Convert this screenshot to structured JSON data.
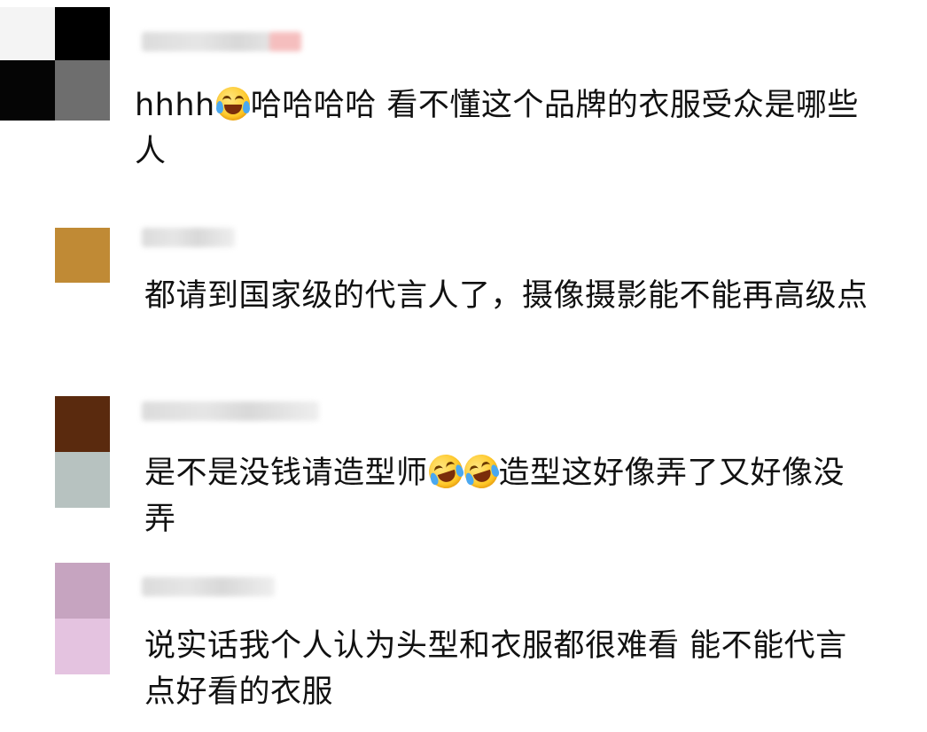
{
  "comments": [
    {
      "text_before": "hhhh",
      "text_after": "哈哈哈哈 看不懂这个品牌的衣服受众是哪些人",
      "emoji_1": "joy-tears-emoji",
      "avatar_colors": [
        "#000000",
        "#4a4a4a",
        "#1a1a1a",
        "#7a7a7a"
      ],
      "username_tint": "#f2a7a7"
    },
    {
      "text": "都请到国家级的代言人了，摄像摄影能不能再高级点",
      "avatar_colors": [
        "#c08a35"
      ]
    },
    {
      "text_before": "是不是没钱请造型师",
      "text_after": "造型这好像弄了又好像没弄",
      "emoji_1": "rolling-laughing-emoji",
      "emoji_2": "rolling-laughing-emoji",
      "avatar_colors": [
        "#5a2a10",
        "#b9c4c2"
      ]
    },
    {
      "text": "说实话我个人认为头型和衣服都很难看 能不能代言点好看的衣服",
      "avatar_colors": [
        "#c8a6c2",
        "#e6c4e2"
      ]
    }
  ]
}
